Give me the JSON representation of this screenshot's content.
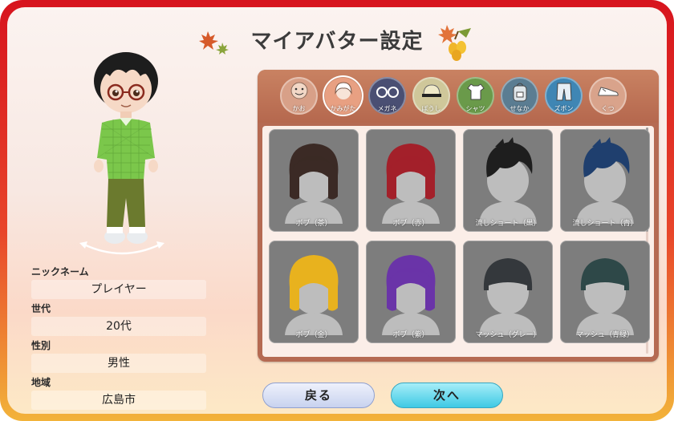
{
  "screen": {
    "title": "マイアバター設定"
  },
  "profile": {
    "nickname_label": "ニックネーム",
    "nickname_value": "プレイヤー",
    "age_label": "世代",
    "age_value": "20代",
    "gender_label": "性別",
    "gender_value": "男性",
    "region_label": "地域",
    "region_value": "広島市"
  },
  "tabs": [
    {
      "label": "かお",
      "icon": "face-icon",
      "color": "#d8a088",
      "active": false
    },
    {
      "label": "かみがた",
      "icon": "hairstyle-icon",
      "color": "#e8a082",
      "active": true
    },
    {
      "label": "メガネ",
      "icon": "glasses-icon",
      "color": "#4a4f73",
      "active": false
    },
    {
      "label": "ぼうし",
      "icon": "hat-icon",
      "color": "#cfc79a",
      "active": false
    },
    {
      "label": "シャツ",
      "icon": "shirt-icon",
      "color": "#6a9a4a",
      "active": false
    },
    {
      "label": "せなか",
      "icon": "backpack-icon",
      "color": "#5b7d92",
      "active": false
    },
    {
      "label": "ズボン",
      "icon": "pants-icon",
      "color": "#3f86b4",
      "active": false
    },
    {
      "label": "くつ",
      "icon": "shoes-icon",
      "color": "#d9a38b",
      "active": false
    }
  ],
  "hair_items": [
    {
      "label": "ボブ（茶）",
      "hair_color": "#3b2a25",
      "style": "bob"
    },
    {
      "label": "ボブ（赤）",
      "hair_color": "#a3202a",
      "style": "bob"
    },
    {
      "label": "流しショート（黒）",
      "hair_color": "#1e1e1e",
      "style": "short"
    },
    {
      "label": "流しショート（青）",
      "hair_color": "#1f3f6e",
      "style": "short"
    },
    {
      "label": "ボブ（金）",
      "hair_color": "#e8b21e",
      "style": "bob"
    },
    {
      "label": "ボブ（紫）",
      "hair_color": "#6a34a8",
      "style": "bob"
    },
    {
      "label": "マッシュ（グレー）",
      "hair_color": "#34383c",
      "style": "mash"
    },
    {
      "label": "マッシュ（青緑）",
      "hair_color": "#2e4848",
      "style": "mash"
    }
  ],
  "buttons": {
    "back_label": "戻る",
    "next_label": "次へ"
  },
  "colors": {
    "frame_red": "#d7141e",
    "panel_brown": "#b56a52",
    "next_cyan": "#3fc9e4",
    "back_lavender": "#c8d2ef"
  }
}
